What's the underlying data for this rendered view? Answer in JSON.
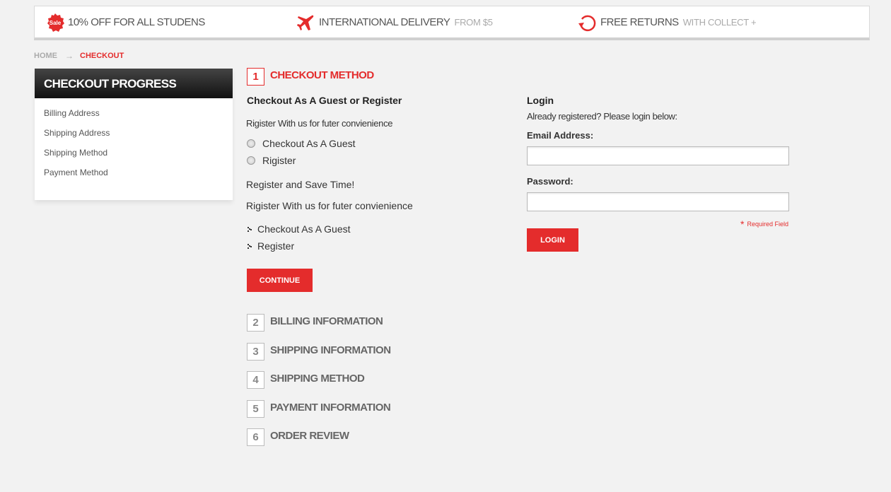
{
  "promo": {
    "items": [
      {
        "badge": "Sale",
        "main": "10% OFF FOR ALL STUDENS",
        "sub": ""
      },
      {
        "main": "INTERNATIONAL DELIVERY",
        "sub": "FROM $5",
        "icon": "plane-icon"
      },
      {
        "main": "FREE RETURNS",
        "sub": "WITH COLLECT +",
        "icon": "return-arrow-icon"
      }
    ]
  },
  "breadcrumb": {
    "home": "HOME",
    "current": "CHECKOUT"
  },
  "sidebar": {
    "title": "CHECKOUT PROGRESS",
    "items": [
      "Billing Address",
      "Shipping Address",
      "Shipping Method",
      "Payment Method"
    ]
  },
  "steps": [
    {
      "num": "1",
      "title": "CHECKOUT METHOD",
      "active": true
    },
    {
      "num": "2",
      "title": "BILLING INFORMATION"
    },
    {
      "num": "3",
      "title": "SHIPPING INFORMATION"
    },
    {
      "num": "4",
      "title": "SHIPPING METHOD"
    },
    {
      "num": "5",
      "title": "PAYMENT INFORMATION"
    },
    {
      "num": "6",
      "title": "ORDER REVIEW"
    }
  ],
  "checkout": {
    "heading": "Checkout As A Guest or Register",
    "intro": "Rigister With us for futer convienience",
    "radio_guest": "Checkout As A Guest",
    "radio_register": "Rigister",
    "save_time": "Register  and Save Time!",
    "intro2": "Rigister With us for futer convienience",
    "bullet_guest": "Checkout As A Guest",
    "bullet_register": "Register",
    "continue_label": "CONTINUE"
  },
  "login": {
    "title": "Login",
    "subtitle": "Already registered? Please login below:",
    "email_label": "Email Address:",
    "email_value": "",
    "password_label": "Password:",
    "password_value": "",
    "required_star": "*",
    "required_text": "Required Field",
    "button_label": "LOGIN"
  },
  "colors": {
    "accent": "#e42c2c",
    "sidebar_head": "#222222",
    "background": "#f2f2f2"
  }
}
